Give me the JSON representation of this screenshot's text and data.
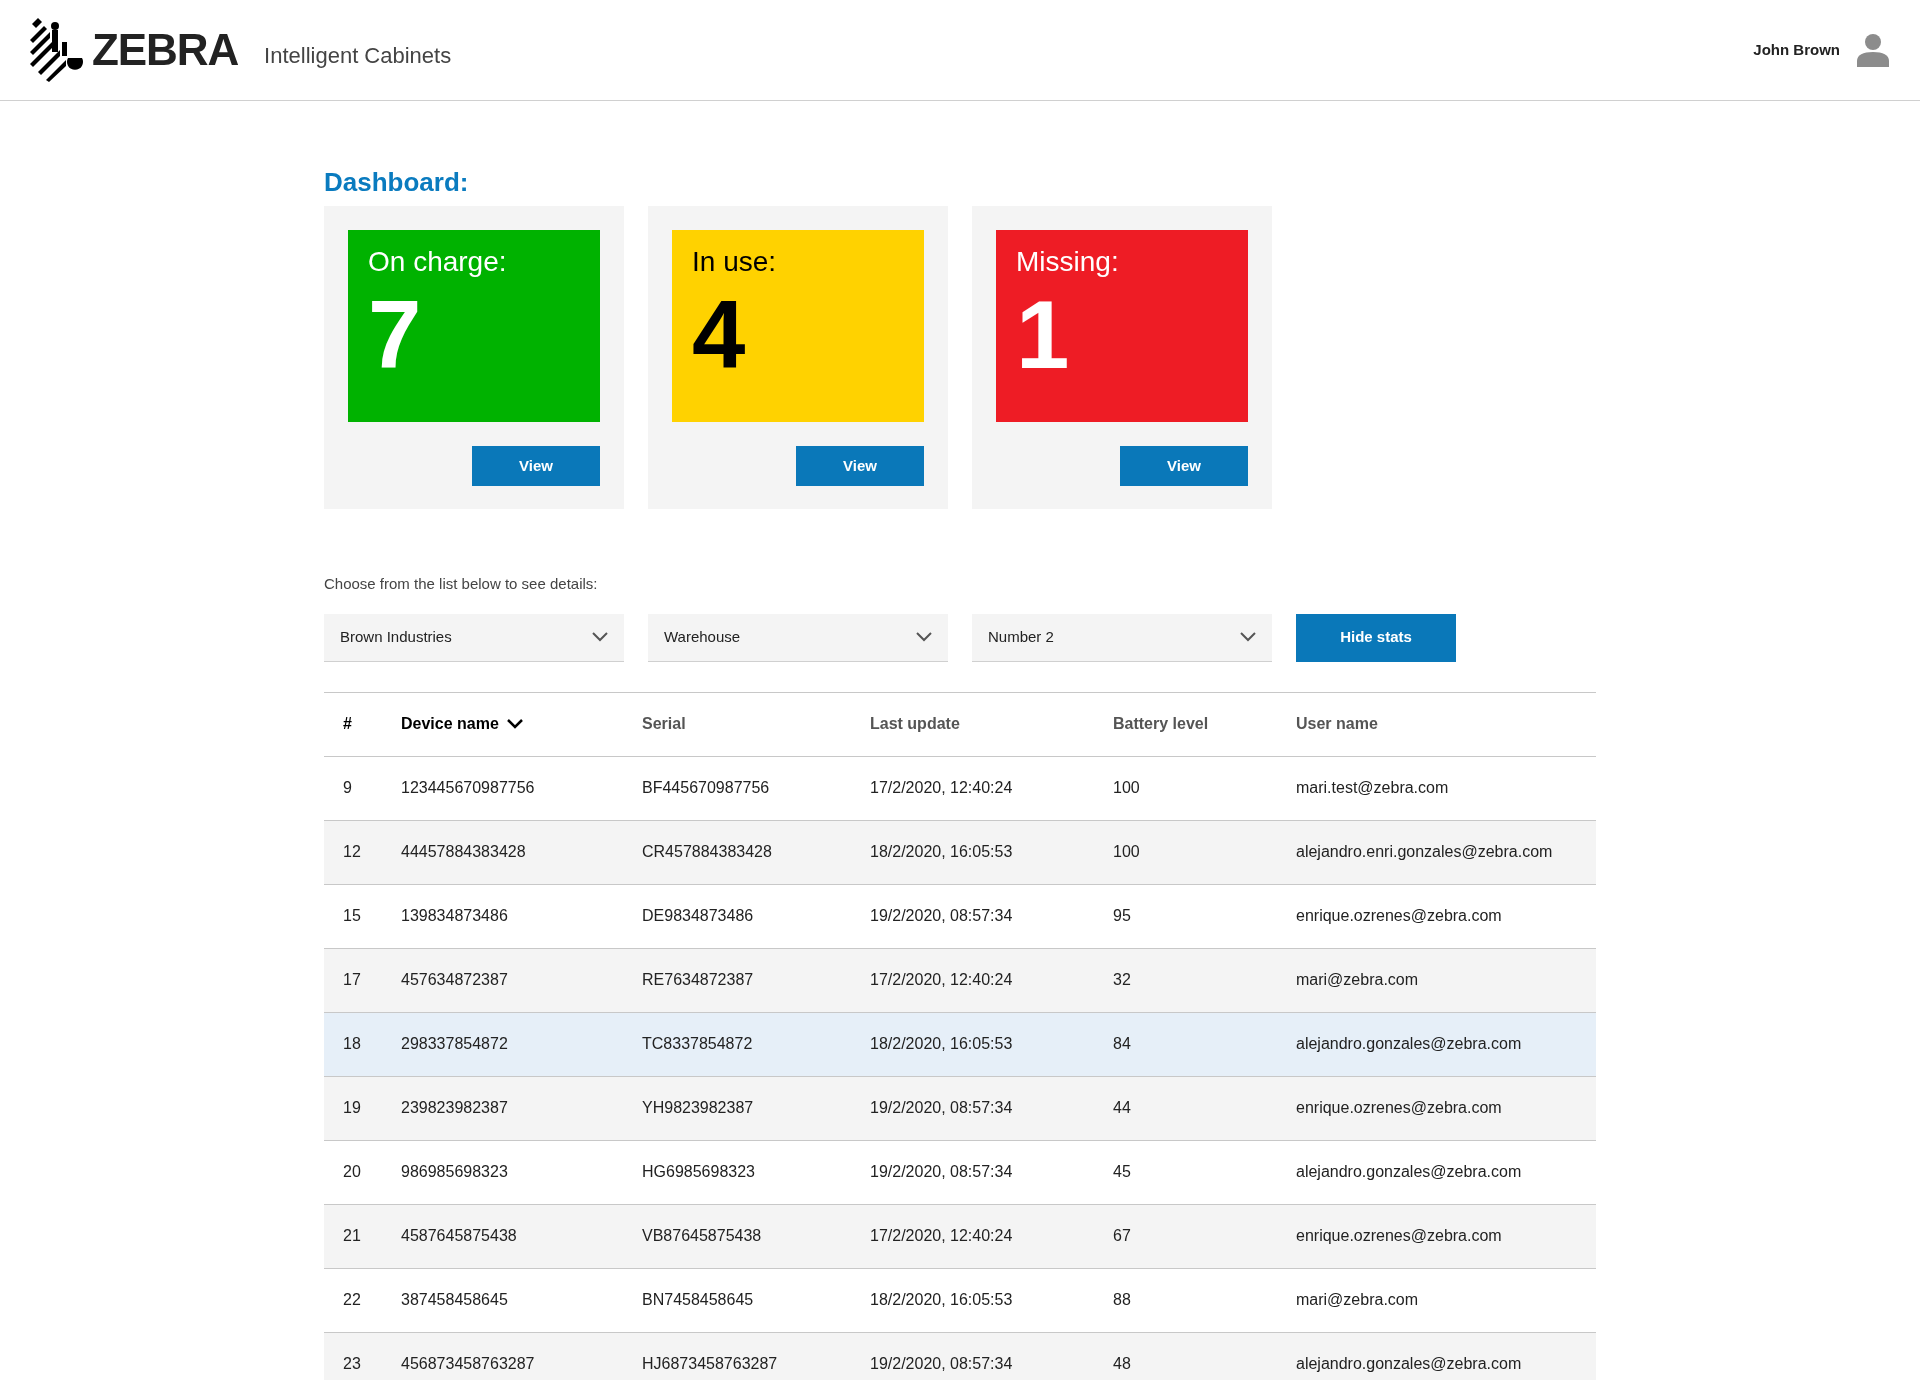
{
  "header": {
    "logo": "ZEBRA",
    "app_name": "Intelligent Cabinets",
    "user_name": "John Brown"
  },
  "dashboard": {
    "title": "Dashboard:",
    "cards": [
      {
        "label": "On charge:",
        "count": "7",
        "color": "#00b200",
        "button": "View"
      },
      {
        "label": "In use:",
        "count": "4",
        "color": "#ffd200",
        "button": "View"
      },
      {
        "label": "Missing:",
        "count": "1",
        "color": "#ee1c25",
        "button": "View"
      }
    ]
  },
  "filters": {
    "hint": "Choose from the list below to see details:",
    "dropdowns": [
      "Brown Industries",
      "Warehouse",
      "Number 2"
    ],
    "button": "Hide stats"
  },
  "table": {
    "columns": [
      {
        "label": "#",
        "sorted": false
      },
      {
        "label": "Device name",
        "sorted": true
      },
      {
        "label": "Serial",
        "sorted": false
      },
      {
        "label": "Last update",
        "sorted": false
      },
      {
        "label": "Battery level",
        "sorted": false
      },
      {
        "label": "User name",
        "sorted": false
      }
    ],
    "rows": [
      {
        "cells": [
          "9",
          "123445670987756",
          "BF445670987756",
          "17/2/2020, 12:40:24",
          "100",
          "mari.test@zebra.com"
        ],
        "selected": false
      },
      {
        "cells": [
          "12",
          "44457884383428",
          "CR457884383428",
          "18/2/2020, 16:05:53",
          "100",
          "alejandro.enri.gonzales@zebra.com"
        ],
        "selected": false
      },
      {
        "cells": [
          "15",
          "139834873486",
          "DE9834873486",
          "19/2/2020, 08:57:34",
          "95",
          "enrique.ozrenes@zebra.com"
        ],
        "selected": false
      },
      {
        "cells": [
          "17",
          "457634872387",
          "RE7634872387",
          "17/2/2020, 12:40:24",
          "32",
          "mari@zebra.com"
        ],
        "selected": false
      },
      {
        "cells": [
          "18",
          "298337854872",
          "TC8337854872",
          "18/2/2020, 16:05:53",
          "84",
          "alejandro.gonzales@zebra.com"
        ],
        "selected": true
      },
      {
        "cells": [
          "19",
          "239823982387",
          "YH9823982387",
          "19/2/2020, 08:57:34",
          "44",
          "enrique.ozrenes@zebra.com"
        ],
        "selected": false
      },
      {
        "cells": [
          "20",
          "986985698323",
          "HG6985698323",
          "19/2/2020, 08:57:34",
          "45",
          "alejandro.gonzales@zebra.com"
        ],
        "selected": false
      },
      {
        "cells": [
          "21",
          "4587645875438",
          "VB87645875438",
          "17/2/2020, 12:40:24",
          "67",
          "enrique.ozrenes@zebra.com"
        ],
        "selected": false
      },
      {
        "cells": [
          "22",
          "387458458645",
          "BN7458458645",
          "18/2/2020, 16:05:53",
          "88",
          "mari@zebra.com"
        ],
        "selected": false
      },
      {
        "cells": [
          "23",
          "456873458763287",
          "HJ6873458763287",
          "19/2/2020, 08:57:34",
          "48",
          "alejandro.gonzales@zebra.com"
        ],
        "selected": false
      }
    ]
  }
}
